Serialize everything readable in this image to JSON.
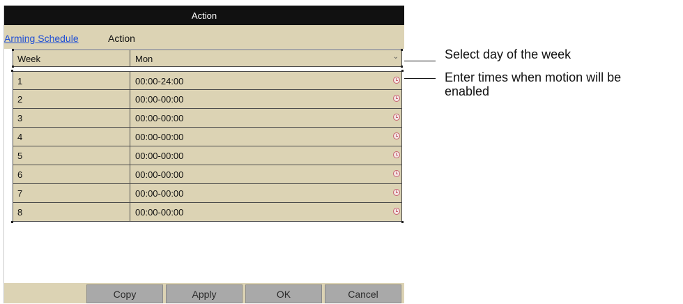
{
  "window": {
    "title": "Action"
  },
  "tabs": [
    {
      "label": "Arming Schedule",
      "active": true
    },
    {
      "label": "Action",
      "active": false
    }
  ],
  "week_row": {
    "label": "Week",
    "value": "Mon"
  },
  "schedule_rows": [
    {
      "index": "1",
      "time": "00:00-24:00"
    },
    {
      "index": "2",
      "time": "00:00-00:00"
    },
    {
      "index": "3",
      "time": "00:00-00:00"
    },
    {
      "index": "4",
      "time": "00:00-00:00"
    },
    {
      "index": "5",
      "time": "00:00-00:00"
    },
    {
      "index": "6",
      "time": "00:00-00:00"
    },
    {
      "index": "7",
      "time": "00:00-00:00"
    },
    {
      "index": "8",
      "time": "00:00-00:00"
    }
  ],
  "buttons": {
    "copy": "Copy",
    "apply": "Apply",
    "ok": "OK",
    "cancel": "Cancel"
  },
  "callouts": {
    "week": "Select day of the week",
    "times_line1": "Enter times when motion will be",
    "times_line2": "enabled"
  },
  "icons": {
    "dropdown": "chevron-down-icon",
    "row_action": "clock-icon"
  },
  "colors": {
    "panel": "#dcd3b4",
    "titlebar": "#111111",
    "link": "#1f4fd6",
    "button": "#a9a9a9"
  }
}
